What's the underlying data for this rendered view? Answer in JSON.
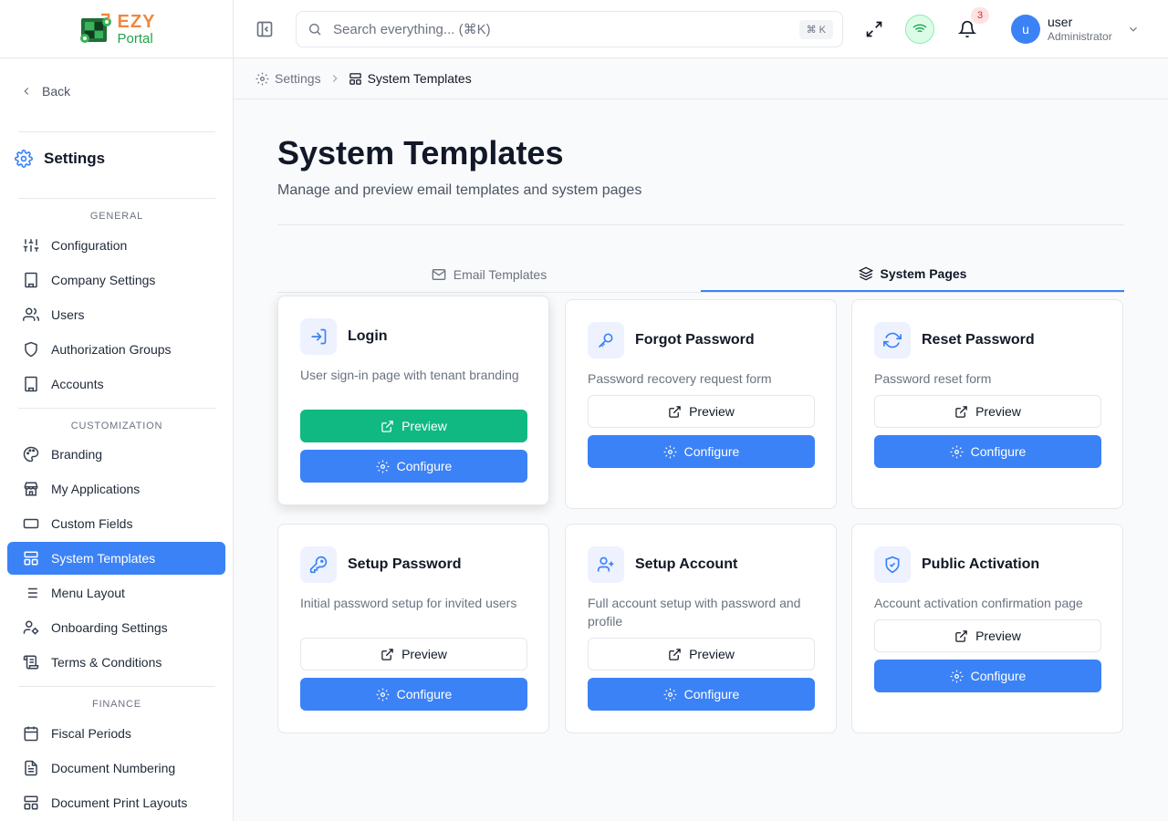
{
  "brand": {
    "line1": "EZY",
    "line2": "Portal"
  },
  "sidebar": {
    "back_label": "Back",
    "title": "Settings",
    "sections": [
      {
        "label": "GENERAL",
        "items": [
          {
            "label": "Configuration",
            "icon": "sliders-icon"
          },
          {
            "label": "Company Settings",
            "icon": "building-icon"
          },
          {
            "label": "Users",
            "icon": "users-icon"
          },
          {
            "label": "Authorization Groups",
            "icon": "shield-icon"
          },
          {
            "label": "Accounts",
            "icon": "building-icon"
          }
        ]
      },
      {
        "label": "CUSTOMIZATION",
        "items": [
          {
            "label": "Branding",
            "icon": "palette-icon"
          },
          {
            "label": "My Applications",
            "icon": "store-icon"
          },
          {
            "label": "Custom Fields",
            "icon": "input-icon"
          },
          {
            "label": "System Templates",
            "icon": "layout-icon",
            "active": true
          },
          {
            "label": "Menu Layout",
            "icon": "list-icon"
          },
          {
            "label": "Onboarding Settings",
            "icon": "user-cog-icon"
          },
          {
            "label": "Terms & Conditions",
            "icon": "scroll-icon"
          }
        ]
      },
      {
        "label": "FINANCE",
        "items": [
          {
            "label": "Fiscal Periods",
            "icon": "calendar-icon"
          },
          {
            "label": "Document Numbering",
            "icon": "file-text-icon"
          },
          {
            "label": "Document Print Layouts",
            "icon": "layout-icon"
          }
        ]
      }
    ]
  },
  "header": {
    "search_placeholder": "Search everything... (⌘K)",
    "search_shortcut": "⌘ K",
    "notification_count": "3",
    "user_initial": "u",
    "user_name": "user",
    "user_role": "Administrator"
  },
  "breadcrumb": {
    "parent": "Settings",
    "current": "System Templates"
  },
  "page": {
    "title": "System Templates",
    "subtitle": "Manage and preview email templates and system pages",
    "tabs": [
      {
        "label": "Email Templates",
        "icon": "mail-icon",
        "active": false
      },
      {
        "label": "System Pages",
        "icon": "layers-icon",
        "active": true
      }
    ],
    "preview_label": "Preview",
    "configure_label": "Configure",
    "cards": [
      {
        "title": "Login",
        "description": "User sign-in page with tenant branding",
        "icon": "log-in-icon"
      },
      {
        "title": "Forgot Password",
        "description": "Password recovery request form",
        "icon": "key-icon"
      },
      {
        "title": "Reset Password",
        "description": "Password reset form",
        "icon": "refresh-icon"
      },
      {
        "title": "Setup Password",
        "description": "Initial password setup for invited users",
        "icon": "key-round-icon"
      },
      {
        "title": "Setup Account",
        "description": "Full account setup with password and profile",
        "icon": "user-plus-icon"
      },
      {
        "title": "Public Activation",
        "description": "Account activation confirmation page",
        "icon": "shield-check-icon"
      }
    ]
  },
  "colors": {
    "accent": "#3b82f6",
    "success": "#10b981",
    "brand_orange": "#f0883e",
    "brand_green": "#22a34a"
  }
}
